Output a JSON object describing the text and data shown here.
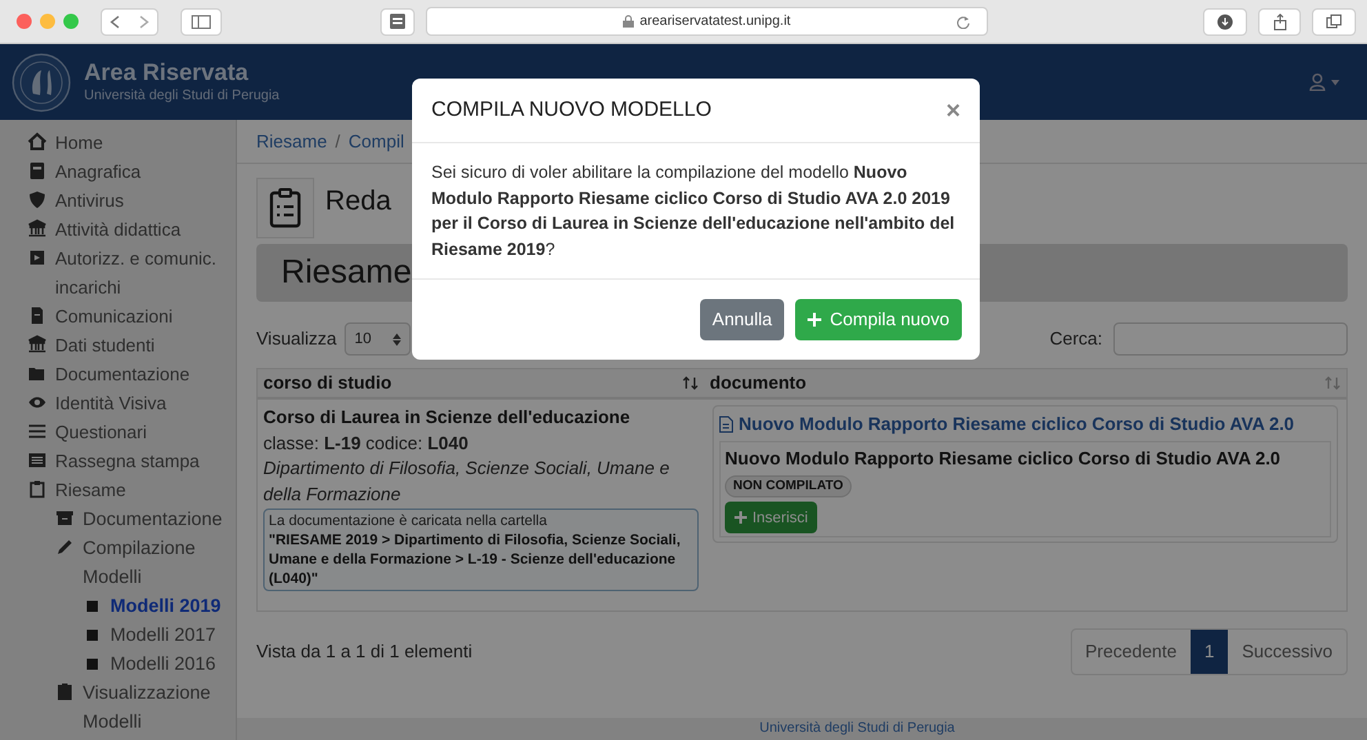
{
  "browser": {
    "url": "areariservatatest.unipg.it"
  },
  "header": {
    "title": "Area Riservata",
    "subtitle": "Università degli Studi di Perugia"
  },
  "sidebar": {
    "items": [
      {
        "label": "Home",
        "selected": false
      },
      {
        "label": "Anagrafica",
        "selected": false
      },
      {
        "label": "Antivirus",
        "selected": false
      },
      {
        "label": "Attività didattica",
        "selected": false
      },
      {
        "label": "Autorizz. e comunic. incarichi",
        "selected": false
      },
      {
        "label": "Comunicazioni",
        "selected": false
      },
      {
        "label": "Dati studenti",
        "selected": false
      },
      {
        "label": "Documentazione",
        "selected": false
      },
      {
        "label": "Identità Visiva",
        "selected": false
      },
      {
        "label": "Questionari",
        "selected": false
      },
      {
        "label": "Rassegna stampa",
        "selected": false
      },
      {
        "label": "Riesame",
        "selected": false,
        "children": [
          {
            "label": "Documentazione",
            "selected": false
          },
          {
            "label": "Compilazione Modelli",
            "selected": false,
            "children": [
              {
                "label": "Modelli 2019",
                "selected": true
              },
              {
                "label": "Modelli 2017",
                "selected": false
              },
              {
                "label": "Modelli 2016",
                "selected": false
              }
            ]
          },
          {
            "label": "Visualizzazione Modelli",
            "selected": false
          }
        ]
      }
    ]
  },
  "breadcrumb": {
    "items": [
      "Riesame",
      "Compil"
    ],
    "separator": "/"
  },
  "page": {
    "heading": "Reda",
    "section_title": "Riesame"
  },
  "table_controls": {
    "show_label": "Visualizza",
    "page_size": "10",
    "search_label": "Cerca:"
  },
  "table": {
    "columns": [
      "corso di studio",
      "documento"
    ],
    "rows": [
      {
        "course": "Corso di Laurea in Scienze dell'educazione",
        "class_line": "classe: **L-19** codice: **L040**",
        "department": "Dipartimento di Filosofia, Scienze Sociali, Umane e della Formazione",
        "note_intro": "La documentazione è caricata nella cartella",
        "note_path": "\"RIESAME 2019 > Dipartimento di Filosofia, Scienze Sociali, Umane e della Formazione > L-19 - Scienze dell'educazione (L040)\"",
        "doc_link": "Nuovo Modulo Rapporto Riesame ciclico Corso di Studio AVA 2.0",
        "doc_title": "Nuovo Modulo Rapporto Riesame ciclico Corso di Studio AVA 2.0",
        "status": "NON COMPILATO",
        "action": "Inserisci"
      }
    ]
  },
  "summary": "Vista da 1 a 1 di 1 elementi",
  "pagination": [
    {
      "label": "Precedente",
      "selected": false
    },
    {
      "label": "1",
      "selected": true
    },
    {
      "label": "Successivo",
      "selected": false
    }
  ],
  "footer": "Università degli Studi di Perugia",
  "modal": {
    "title": "COMPILA NUOVO MODELLO",
    "close": "×",
    "message": "Sei sicuro di voler abilitare la compilazione del modello **Nuovo Modulo Rapporto Riesame ciclico Corso di Studio AVA 2.0 2019 per il Corso di Laurea in Scienze dell'educazione nell'ambito del Riesame 2019**?",
    "buttons": [
      {
        "label": "Annulla",
        "kind": "secondary"
      },
      {
        "label": "Compila nuovo",
        "kind": "primary"
      }
    ]
  }
}
